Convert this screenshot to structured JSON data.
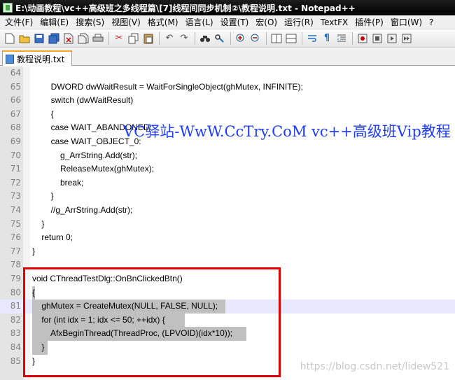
{
  "window": {
    "title": "E:\\动画教程\\vc++高级班之多线程篇\\[7]线程间同步机制②\\教程说明.txt - Notepad++"
  },
  "menu": [
    "文件(F)",
    "编辑(E)",
    "搜索(S)",
    "视图(V)",
    "格式(M)",
    "语言(L)",
    "设置(T)",
    "宏(O)",
    "运行(R)",
    "TextFX",
    "插件(P)",
    "窗口(W)",
    "?"
  ],
  "toolbar": {
    "icons": [
      "new-file-icon",
      "open-file-icon",
      "save-icon",
      "save-all-icon",
      "close-icon",
      "close-all-icon",
      "print-icon",
      "cut-icon",
      "copy-icon",
      "paste-icon",
      "undo-icon",
      "redo-icon",
      "find-icon",
      "replace-icon",
      "zoom-in-icon",
      "zoom-out-icon",
      "sync-vertical-icon",
      "sync-horizontal-icon",
      "word-wrap-icon",
      "show-all-chars-icon",
      "indent-guide-icon",
      "macro-record-icon",
      "macro-stop-icon",
      "macro-play-icon",
      "macro-fast-forward-icon"
    ]
  },
  "tab": {
    "label": "教程说明.txt"
  },
  "editor": {
    "lines": [
      {
        "num": "64",
        "text": ""
      },
      {
        "num": "65",
        "text": "        DWORD dwWaitResult = WaitForSingleObject(ghMutex, INFINITE);"
      },
      {
        "num": "66",
        "text": "        switch (dwWaitResult)"
      },
      {
        "num": "67",
        "text": "        {"
      },
      {
        "num": "68",
        "text": "        case WAIT_ABANDONED:"
      },
      {
        "num": "69",
        "text": "        case WAIT_OBJECT_0:"
      },
      {
        "num": "70",
        "text": "            g_ArrString.Add(str);"
      },
      {
        "num": "71",
        "text": "            ReleaseMutex(ghMutex);"
      },
      {
        "num": "72",
        "text": "            break;"
      },
      {
        "num": "73",
        "text": "        }"
      },
      {
        "num": "74",
        "text": "        //g_ArrString.Add(str);"
      },
      {
        "num": "75",
        "text": "    }"
      },
      {
        "num": "76",
        "text": "    return 0;"
      },
      {
        "num": "77",
        "text": "}"
      },
      {
        "num": "78",
        "text": ""
      },
      {
        "num": "79",
        "text": "void CThreadTestDlg::OnBnClickedBtn()"
      },
      {
        "num": "80",
        "text": "{"
      },
      {
        "num": "81",
        "text": "    ghMutex = CreateMutex(NULL, FALSE, NULL);"
      },
      {
        "num": "82",
        "text": "    for (int idx = 1; idx <= 50; ++idx) {"
      },
      {
        "num": "83",
        "text": "        AfxBeginThread(ThreadProc, (LPVOID)(idx*10));"
      },
      {
        "num": "84",
        "text": "    }"
      },
      {
        "num": "85",
        "text": "}"
      }
    ]
  },
  "watermark": "VC驿站-WwW.CcTry.CoM vc++高级班Vip教程",
  "csdn_watermark": "https://blog.csdn.net/lidew521",
  "colors": {
    "title_bar": "#000000",
    "current_line": "#e8e8ff",
    "selection": "#c0c0c0",
    "annotation_box": "#e00000",
    "watermark_text": "#1e3cff"
  }
}
